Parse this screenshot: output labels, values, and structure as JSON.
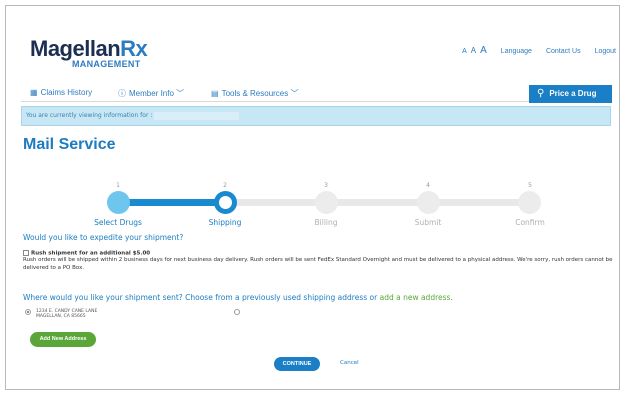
{
  "header": {
    "logo_main": "Magellan",
    "logo_rx": "Rx",
    "logo_sub": "MANAGEMENT",
    "font_sizes": [
      "A",
      "A",
      "A"
    ],
    "utility_links": [
      "Language",
      "Contact Us",
      "Logout"
    ]
  },
  "nav": {
    "items": [
      {
        "label": "Claims History",
        "icon": "calendar-icon"
      },
      {
        "label": "Member Info",
        "icon": "info-icon"
      },
      {
        "label": "Tools & Resources",
        "icon": "document-icon"
      }
    ],
    "price_button": "Price a Drug"
  },
  "banner": {
    "text": "You are currently viewing information for :"
  },
  "page": {
    "title": "Mail Service"
  },
  "stepper": {
    "current_step": 2,
    "steps": [
      {
        "number": "1",
        "label": "Select Drugs",
        "state": "done"
      },
      {
        "number": "2",
        "label": "Shipping",
        "state": "current"
      },
      {
        "number": "3",
        "label": "Billing",
        "state": "todo"
      },
      {
        "number": "4",
        "label": "Submit",
        "state": "todo"
      },
      {
        "number": "5",
        "label": "Confirm",
        "state": "todo"
      }
    ]
  },
  "expedite": {
    "question": "Would you like to expedite your shipment?",
    "checkbox_label": "Rush shipment for an additional $5.00",
    "checked": false,
    "description": "Rush orders will be shipped within 2 business days for next business day delivery. Rush orders will be sent FedEx Standard Overnight and must be delivered to a physical address. We're sorry, rush orders cannot be delivered to a PO Box."
  },
  "shipping": {
    "question": "Where would you like your shipment sent? Choose from a previously used shipping address or",
    "add_link": "add a new address.",
    "address_line1": "1234 E. CANDY CANE LANE",
    "address_line2": "MAGELLAN, CA 85665",
    "add_button": "Add New Address"
  },
  "actions": {
    "continue": "CONTINUE",
    "cancel": "Cancel"
  },
  "colors": {
    "brand_blue": "#1a7fc6",
    "title_blue": "#1c7cc1",
    "green": "#5ba638",
    "banner_bg": "#c8e7f5"
  }
}
